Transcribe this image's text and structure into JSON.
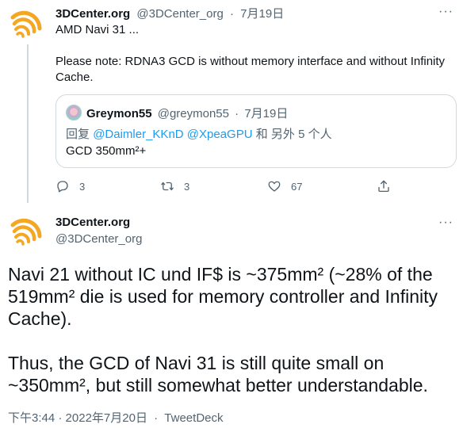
{
  "colors": {
    "text": "#0f1419",
    "muted": "#536471",
    "link": "#1d9bf0",
    "border": "#cfd9de",
    "avatar_orange": "#f5a623"
  },
  "tweet1": {
    "name": "3DCenter.org",
    "handle": "@3DCenter_org",
    "sep": "·",
    "date": "7月19日",
    "more_icon": "more-horizontal-icon",
    "line1": "AMD Navi 31 ...",
    "line2": "Please note: RDNA3 GCD is without memory interface and without Infinity Cache.",
    "quote": {
      "name": "Greymon55",
      "handle": "@greymon55",
      "sep": "·",
      "date": "7月19日",
      "reply_prefix": "回复",
      "mention1": "@Daimler_KKnD",
      "mention2": "@XpeaGPU",
      "reply_suffix": "和 另外 5 个人",
      "text": "GCD 350mm²+"
    },
    "actions": {
      "reply_icon": "reply-icon",
      "reply_count": "3",
      "retweet_icon": "retweet-icon",
      "retweet_count": "3",
      "like_icon": "heart-icon",
      "like_count": "67",
      "share_icon": "share-icon"
    }
  },
  "tweet2": {
    "name": "3DCenter.org",
    "handle": "@3DCenter_org",
    "more_icon": "more-horizontal-icon",
    "paragraph1": "Navi 21 without IC und IF$ is ~375mm² (~28% of the 519mm² die is used for memory controller and Infinity Cache).",
    "paragraph2": "Thus, the GCD of Navi 31 is still quite small on ~350mm², but still somewhat better understandable.",
    "time": "下午3:44",
    "sep": "·",
    "date": "2022年7月20日",
    "source": "TweetDeck"
  }
}
